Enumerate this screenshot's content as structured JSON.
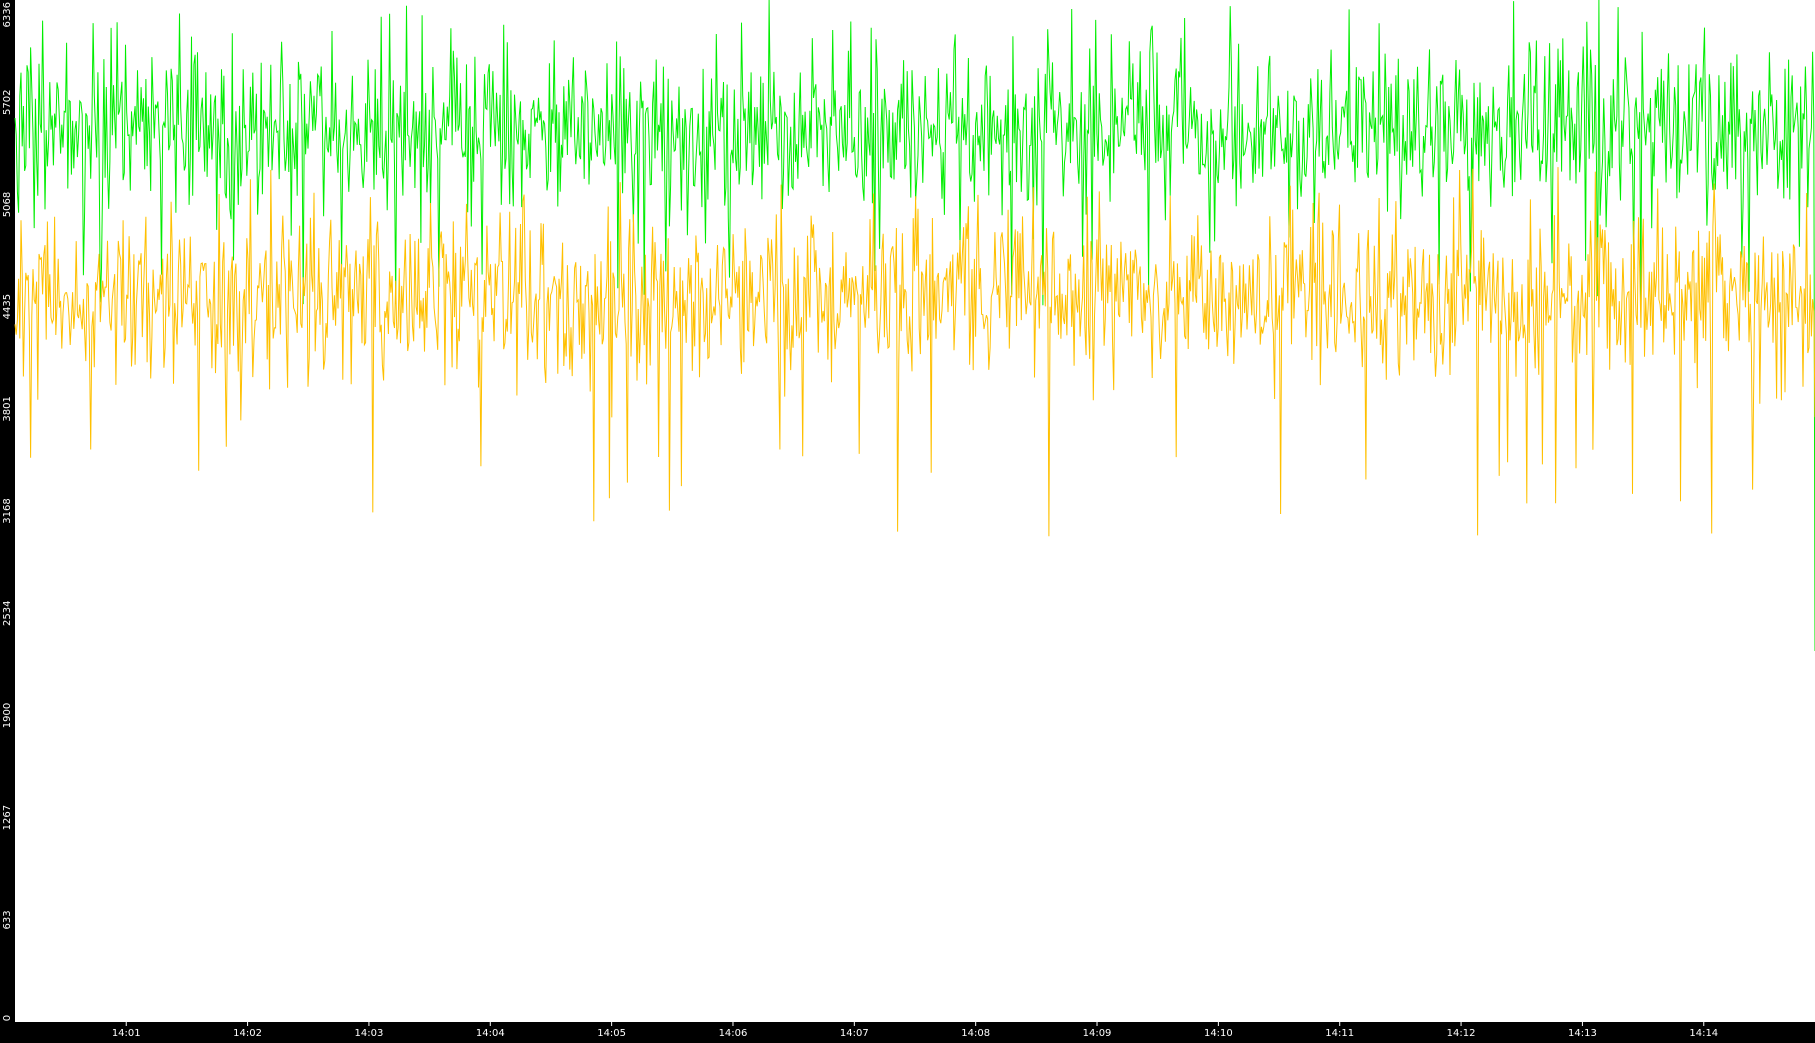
{
  "chart_data": {
    "type": "line",
    "title": "",
    "xlabel": "",
    "ylabel": "",
    "ylim": [
      0,
      6336
    ],
    "x_range": [
      "14:00:05",
      "14:14:55"
    ],
    "y_ticks": [
      "0",
      "633",
      "1267",
      "1900",
      "2534",
      "3168",
      "3801",
      "4435",
      "5068",
      "5702",
      "6336"
    ],
    "x_ticks": [
      "14:01",
      "14:02",
      "14:03",
      "14:04",
      "14:05",
      "14:06",
      "14:07",
      "14:08",
      "14:09",
      "14:10",
      "14:11",
      "14:12",
      "14:13",
      "14:14"
    ],
    "grid": false,
    "legend": "none",
    "background_color": "#ffffff",
    "axis_band_color": "#000000",
    "series": [
      {
        "color": "#00ee00",
        "typical_range": [
          5000,
          6000
        ],
        "mean": 5550,
        "min_value": 4435,
        "max_value": 6336,
        "final_value": 2300
      },
      {
        "color": "#ffc000",
        "typical_range": [
          4000,
          5000
        ],
        "mean": 4500,
        "min_value": 3000,
        "max_value": 5300,
        "final_value": 3750
      }
    ]
  }
}
